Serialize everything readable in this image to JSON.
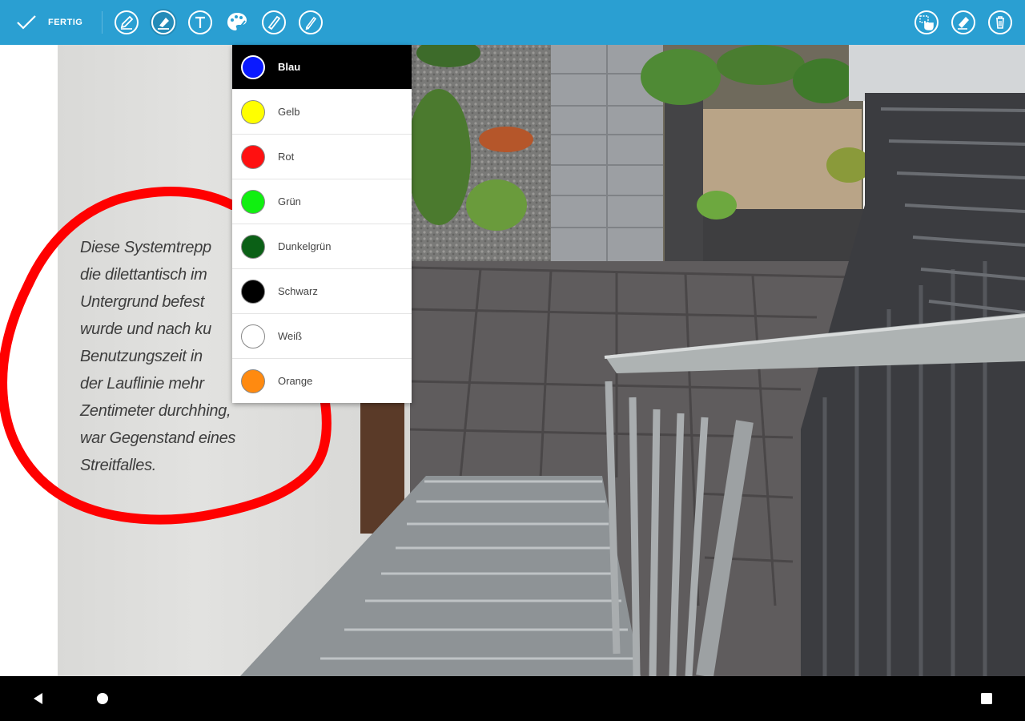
{
  "toolbar": {
    "done_label": "FERTIG",
    "left_tools": [
      {
        "name": "pen-icon"
      },
      {
        "name": "highlighter-icon"
      },
      {
        "name": "text-icon"
      },
      {
        "name": "color-palette-icon"
      },
      {
        "name": "marker-icon"
      },
      {
        "name": "pencil-icon"
      }
    ],
    "right_tools": [
      {
        "name": "select-hand-icon"
      },
      {
        "name": "eraser-icon"
      },
      {
        "name": "trash-icon"
      }
    ],
    "accent_color": "#2a9fd2"
  },
  "article": {
    "lines": [
      "Diese Systemtrepp",
      "die dilettantisch im",
      "Untergrund befest",
      "wurde und nach ku",
      "Benutzungszeit in",
      "der Lauflinie mehr",
      "Zentimeter durchhing,",
      "war Gegenstand eines",
      "Streitfalles."
    ]
  },
  "annotation": {
    "stroke_color": "#ff0000",
    "shape": "freehand-circle"
  },
  "color_menu": {
    "selected": "Blau",
    "items": [
      {
        "label": "Blau",
        "color": "#0a1aff"
      },
      {
        "label": "Gelb",
        "color": "#ffff00"
      },
      {
        "label": "Rot",
        "color": "#ff1010"
      },
      {
        "label": "Grün",
        "color": "#10f010"
      },
      {
        "label": "Dunkelgrün",
        "color": "#0b6016"
      },
      {
        "label": "Schwarz",
        "color": "#000000"
      },
      {
        "label": "Weiß",
        "color": "#ffffff"
      },
      {
        "label": "Orange",
        "color": "#ff8a10"
      }
    ]
  },
  "navbar": {
    "buttons": [
      "back-icon",
      "home-icon",
      "recents-icon"
    ]
  }
}
